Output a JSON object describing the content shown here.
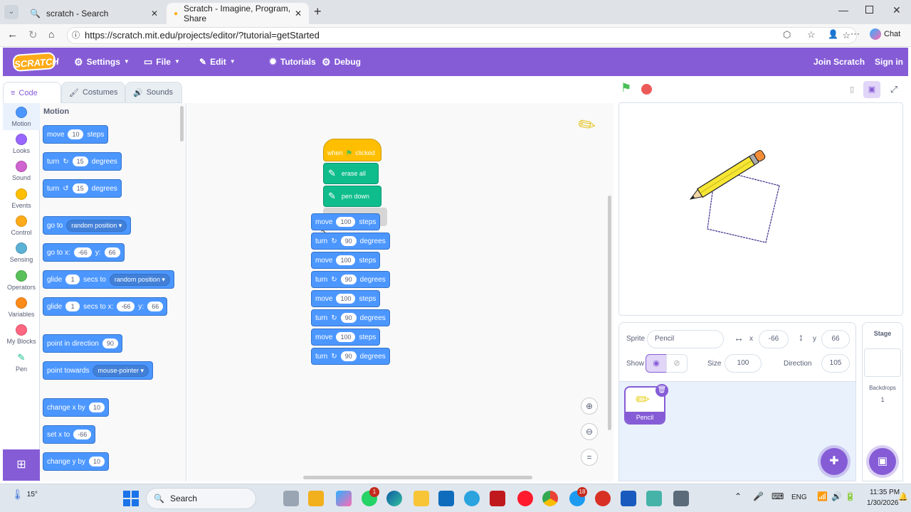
{
  "browser": {
    "tabs": [
      {
        "label": "scratch - Search"
      },
      {
        "label": "Scratch - Imagine, Program, Share"
      }
    ],
    "url": "https://scratch.mit.edu/projects/editor/?tutorial=getStarted",
    "chat_label": "Chat"
  },
  "menubar": {
    "logo": "SCRATCH",
    "settings": "Settings",
    "file": "File",
    "edit": "Edit",
    "tutorials": "Tutorials",
    "debug": "Debug",
    "join": "Join Scratch",
    "signin": "Sign in"
  },
  "editor_tabs": [
    "Code",
    "Costumes",
    "Sounds"
  ],
  "categories": [
    {
      "label": "Motion",
      "color": "#4c97ff"
    },
    {
      "label": "Looks",
      "color": "#9966ff"
    },
    {
      "label": "Sound",
      "color": "#cf63cf"
    },
    {
      "label": "Events",
      "color": "#ffbf00"
    },
    {
      "label": "Control",
      "color": "#ffab19"
    },
    {
      "label": "Sensing",
      "color": "#5cb1d6"
    },
    {
      "label": "Operators",
      "color": "#59c059"
    },
    {
      "label": "Variables",
      "color": "#ff8c1a"
    },
    {
      "label": "My Blocks",
      "color": "#ff6680"
    },
    {
      "label": "Pen",
      "color": "#0fbd8c"
    }
  ],
  "palette": {
    "heading": "Motion",
    "move": {
      "a": "move",
      "v": "10",
      "b": "steps"
    },
    "turn_right": {
      "a": "turn",
      "v": "15",
      "b": "degrees"
    },
    "turn_left": {
      "a": "turn",
      "v": "15",
      "b": "degrees"
    },
    "goto": {
      "a": "go to",
      "d": "random position"
    },
    "gotoxy": {
      "a": "go to x:",
      "x": "-66",
      "yl": "y:",
      "y": "66"
    },
    "glide": {
      "a": "glide",
      "v": "1",
      "b": "secs to",
      "d": "random position"
    },
    "glidexy": {
      "a": "glide",
      "v": "1",
      "b": "secs to x:",
      "x": "-66",
      "yl": "y:",
      "y": "66"
    },
    "point_dir": {
      "a": "point in direction",
      "v": "90"
    },
    "point_towards": {
      "a": "point towards",
      "d": "mouse-pointer"
    },
    "change_x": {
      "a": "change x by",
      "v": "10"
    },
    "set_x": {
      "a": "set x to",
      "v": "-66"
    },
    "change_y": {
      "a": "change y by",
      "v": "10"
    }
  },
  "script": {
    "hat": {
      "a": "when",
      "b": "clicked"
    },
    "erase": "erase all",
    "pendown": "pen down",
    "steps": [
      {
        "a": "move",
        "v": "100",
        "b": "steps"
      },
      {
        "a": "turn",
        "v": "90",
        "b": "degrees"
      },
      {
        "a": "move",
        "v": "100",
        "b": "steps"
      },
      {
        "a": "turn",
        "v": "90",
        "b": "degrees"
      },
      {
        "a": "move",
        "v": "100",
        "b": "steps"
      },
      {
        "a": "turn",
        "v": "90",
        "b": "degrees"
      },
      {
        "a": "move",
        "v": "100",
        "b": "steps"
      },
      {
        "a": "turn",
        "v": "90",
        "b": "degrees"
      }
    ]
  },
  "sprite": {
    "sprite_label": "Sprite",
    "name": "Pencil",
    "x_label": "x",
    "x": "-66",
    "y_label": "y",
    "y": "66",
    "show_label": "Show",
    "size_label": "Size",
    "size": "100",
    "direction_label": "Direction",
    "direction": "105",
    "thumb_name": "Pencil"
  },
  "stage_panel": {
    "title": "Stage",
    "backdrops_label": "Backdrops",
    "backdrops_count": "1"
  },
  "taskbar": {
    "weather": "15°",
    "search": "Search",
    "lang": "ENG",
    "time": "11:35 PM",
    "date": "1/30/2026",
    "badge1": "1",
    "badge2": "18"
  }
}
